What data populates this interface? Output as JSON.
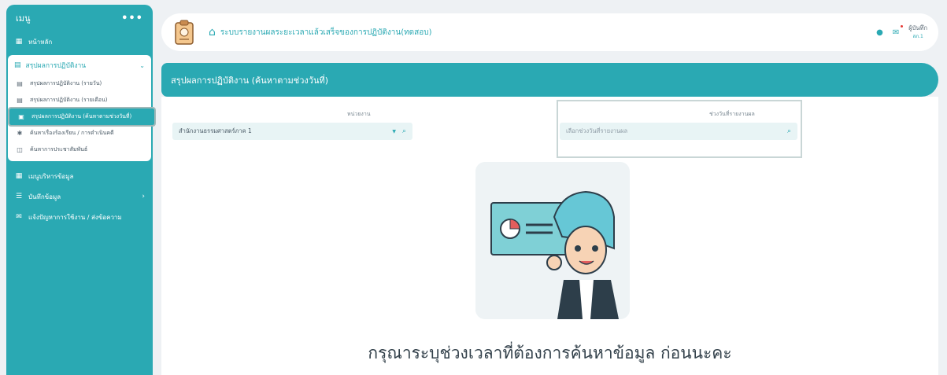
{
  "sidebar": {
    "title": "เมนู",
    "more": "•••",
    "home": "หน้าหลัก",
    "group": {
      "label": "สรุปผลการปฏิบัติงาน",
      "items": [
        {
          "label": "สรุปผลการปฏิบัติงาน (รายวัน)"
        },
        {
          "label": "สรุปผลการปฏิบัติงาน (รายเดือน)"
        },
        {
          "label": "สรุปผลการปฏิบัติงาน (ค้นหาตามช่วงวันที่)"
        },
        {
          "label": "ค้นหาเรื่องร้องเรียน / การดำเนินคดี"
        },
        {
          "label": "ค้นหาการประชาสัมพันธ์"
        }
      ]
    },
    "items": [
      {
        "label": "เมนูบริหารข้อมูล"
      },
      {
        "label": "บันทึกข้อมูล"
      },
      {
        "label": "แจ้งปัญหาการใช้งาน / ส่งข้อความ"
      }
    ]
  },
  "header": {
    "title": "ระบบรายงานผลระยะเวลาแล้วเสร็จของการปฏิบัติงาน(ทดสอบ)",
    "user_name": "ผู้บันทึก",
    "user_role": "สภ.1"
  },
  "main": {
    "heading": "สรุปผลการปฏิบัติงาน (ค้นหาตามช่วงวันที่)",
    "unit_label": "หน่วยงาน",
    "unit_value": "สำนักงานธรรมศาสตร์ภาค 1",
    "date_label": "ช่วงวันที่รายงานผล",
    "date_placeholder": "เลือกช่วงวันที่รายงานผล",
    "message": "กรุณาระบุช่วงเวลาที่ต้องการค้นหาข้อมูล ก่อนนะคะ"
  },
  "colors": {
    "accent": "#2aa9b3",
    "background": "#eef1f4"
  }
}
